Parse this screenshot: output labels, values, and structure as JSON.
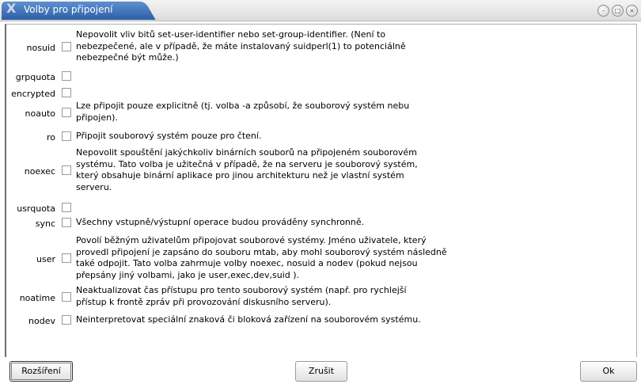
{
  "window": {
    "title": "Volby pro připojení",
    "app_icon": "X",
    "controls": [
      "minimize-icon",
      "maximize-icon",
      "close-icon"
    ]
  },
  "options": [
    {
      "name": "nosuid",
      "desc": [
        "Nepovolit vliv bitů set-user-identifier nebo set-group-identifier. (Není to",
        "nebezpečené, ale v případě, že máte instalovaný suidperl(1) to potenciálně",
        "nebezpečné být může.)"
      ]
    },
    {
      "name": "grpquota",
      "desc": []
    },
    {
      "name": "encrypted",
      "desc": []
    },
    {
      "name": "noauto",
      "desc": [
        "Lze připojit pouze explicitně (tj. volba -a způsobí, že souborový systém nebu",
        "připojen)."
      ]
    },
    {
      "name": "ro",
      "desc": [
        "Připojit souborový systém pouze pro čtení."
      ]
    },
    {
      "name": "noexec",
      "desc": [
        "Nepovolit spouštění jakýchkoliv binárních souborů na připojeném souborovém",
        "systému. Tato volba je užitečná v případě, že na serveru je souborový systém,",
        "který obsahuje binární aplikace pro jinou architekturu než je vlastní systém",
        "serveru."
      ]
    },
    {
      "name": "usrquota",
      "desc": []
    },
    {
      "name": "sync",
      "desc": [
        "Všechny vstupně/výstupní operace budou prováděny synchronně."
      ]
    },
    {
      "name": "user",
      "desc": [
        "Povolí běžným uživatelům připojovat souborové systémy. Jméno uživatele, který",
        "provedl připojení je zapsáno do souboru mtab, aby mohl souborový systém následně",
        "také odpojit. Tato volba zahrmuje volby noexec, nosuid a nodev (pokud nejsou",
        "přepsány jiný volbami, jako je user,exec,dev,suid )."
      ]
    },
    {
      "name": "noatime",
      "desc": [
        "Neaktualizovat čas přístupu pro tento souborový systém (např. pro rychlejší",
        "přístup k frontě zpráv při provozování diskusního serveru)."
      ]
    },
    {
      "name": "nodev",
      "desc": [
        "Neinterpretovat speciální znaková či bloková zařízení na souborovém systému."
      ]
    }
  ],
  "buttons": {
    "extensions": "Rozšíření",
    "cancel": "Zrušit",
    "ok": "Ok"
  }
}
